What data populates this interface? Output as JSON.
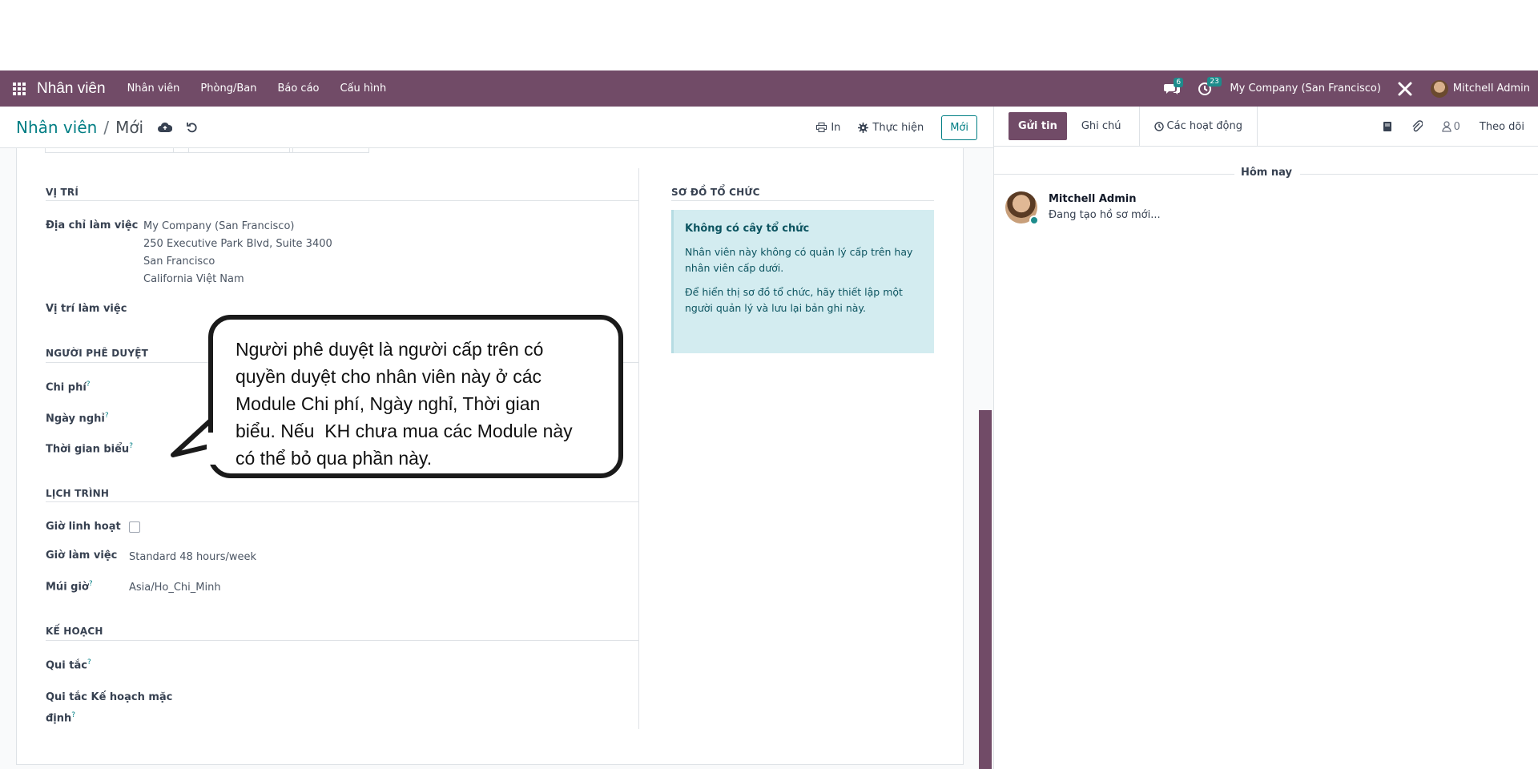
{
  "navbar": {
    "app_title": "Nhân viên",
    "menu": [
      "Nhân viên",
      "Phòng/Ban",
      "Báo cáo",
      "Cấu hình"
    ],
    "messages_count": "6",
    "activities_count": "23",
    "company": "My Company (San Francisco)",
    "user": "Mitchell Admin",
    "brand_color": "#714B67"
  },
  "control": {
    "breadcrumb_parent": "Nhân viên",
    "breadcrumb_sep": "/",
    "breadcrumb_current": "Mới",
    "print_label": "In",
    "action_label": "Thực hiện",
    "new_label": "Mới"
  },
  "form": {
    "location": {
      "title": "VỊ TRÍ",
      "work_address_label": "Địa chỉ làm việc",
      "work_address_lines": [
        "My Company (San Francisco)",
        "250 Executive Park Blvd, Suite 3400",
        "San Francisco",
        "California Việt Nam"
      ],
      "work_location_label": "Vị trí làm việc"
    },
    "approvers": {
      "title": "NGƯỜI PHÊ DUYỆT",
      "expense_label": "Chi phí",
      "timeoff_label": "Ngày nghỉ",
      "timesheet_label": "Thời gian biểu"
    },
    "schedule": {
      "title": "LỊCH TRÌNH",
      "flexible_label": "Giờ linh hoạt",
      "flexible_checked": false,
      "working_hours_label": "Giờ làm việc",
      "working_hours_value": "Standard 48 hours/week",
      "timezone_label": "Múi giờ",
      "timezone_value": "Asia/Ho_Chi_Minh"
    },
    "planning": {
      "title": "KẾ HOẠCH",
      "roles_label": "Qui tắc",
      "default_role_label_1": "Qui tắc Kế hoạch mặc",
      "default_role_label_2": "định"
    },
    "org_chart": {
      "title": "SƠ ĐỒ TỔ CHỨC",
      "box_title": "Không có cây tổ chức",
      "p1": "Nhân viên này không có quản lý cấp trên hay nhân viên cấp dưới.",
      "p2": "Để hiển thị sơ đồ tổ chức, hãy thiết lập một người quản lý và lưu lại bản ghi này."
    },
    "tooltip_mark": "?"
  },
  "callout": {
    "lines": [
      "Người phê duyệt là người cấp trên có",
      "quyền duyệt cho nhân viên này ở các",
      "Module Chi phí, Ngày nghỉ, Thời gian",
      "biểu. Nếu  KH chưa mua các Module này",
      "có thể bỏ qua phần này."
    ]
  },
  "chatter": {
    "send_label": "Gửi tin",
    "note_label": "Ghi chú",
    "activities_label": "Các hoạt động",
    "followers_count": "0",
    "follow_label": "Theo dõi",
    "today_label": "Hôm nay",
    "message_author": "Mitchell Admin",
    "message_body": "Đang tạo hồ sơ mới..."
  }
}
